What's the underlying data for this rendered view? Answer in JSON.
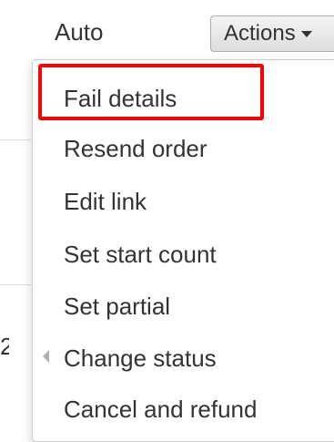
{
  "header": {
    "mode_label": "Auto",
    "actions_label": "Actions",
    "actions_icon": "caret-down-icon"
  },
  "background": {
    "row_fragment": "2."
  },
  "dropdown": {
    "items": [
      {
        "label": "Fail details"
      },
      {
        "label": "Resend order"
      },
      {
        "label": "Edit link"
      },
      {
        "label": "Set start count"
      },
      {
        "label": "Set partial"
      },
      {
        "label": "Change status",
        "icon": "caret-left-icon"
      },
      {
        "label": "Cancel and refund"
      }
    ],
    "highlight_color": "#ff0000"
  }
}
